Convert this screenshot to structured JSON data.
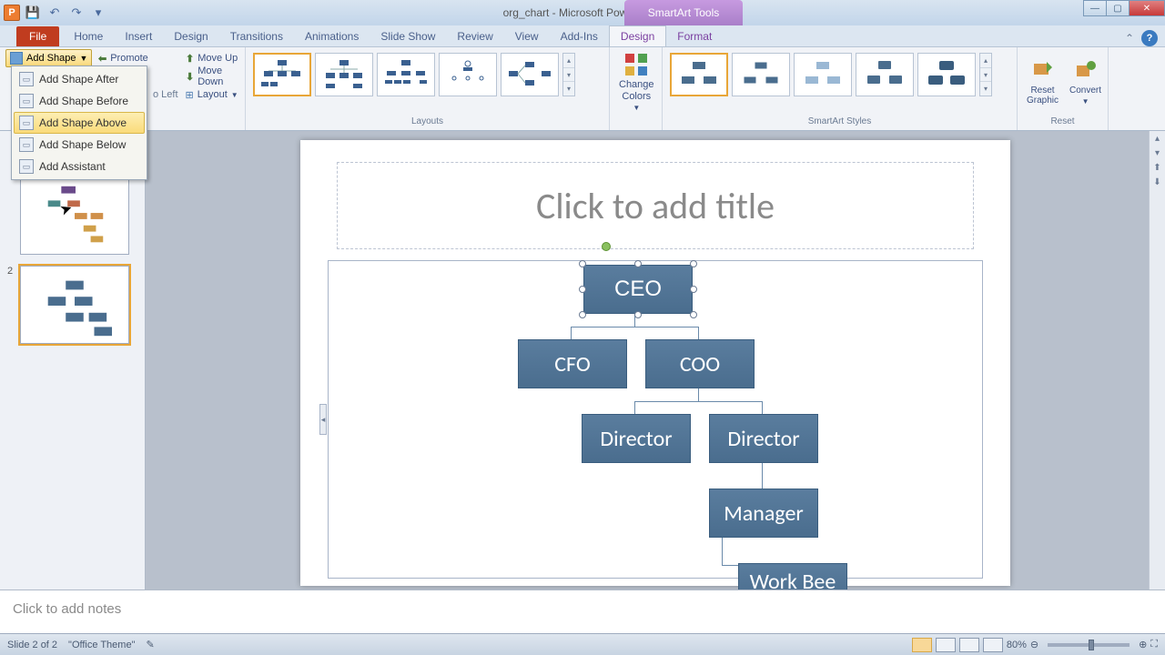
{
  "titlebar": {
    "app_icon_text": "P",
    "doc_title": "org_chart - Microsoft PowerPoint",
    "tools_label": "SmartArt Tools"
  },
  "tabs": {
    "file": "File",
    "home": "Home",
    "insert": "Insert",
    "design": "Design",
    "transitions": "Transitions",
    "animations": "Animations",
    "slideshow": "Slide Show",
    "review": "Review",
    "view": "View",
    "addins": "Add-Ins",
    "sa_design": "Design",
    "sa_format": "Format"
  },
  "ribbon": {
    "add_shape": "Add Shape",
    "promote": "Promote",
    "move_up": "Move Up",
    "move_down": "Move Down",
    "right_to_left": "o Left",
    "layout": "Layout",
    "layouts_label": "Layouts",
    "change_colors": "Change Colors",
    "styles_label": "SmartArt Styles",
    "reset_graphic": "Reset Graphic",
    "convert": "Convert",
    "reset_label": "Reset"
  },
  "dropdown": {
    "after": "Add Shape After",
    "before": "Add Shape Before",
    "above": "Add Shape Above",
    "below": "Add Shape Below",
    "assistant": "Add Assistant"
  },
  "slide": {
    "title_placeholder": "Click to add title",
    "notes_placeholder": "Click to add notes",
    "nodes": {
      "ceo": "CEO",
      "cfo": "CFO",
      "coo": "COO",
      "dir1": "Director",
      "dir2": "Director",
      "mgr": "Manager",
      "worker": "Work Bee"
    }
  },
  "thumbnails": {
    "slide2_num": "2"
  },
  "status": {
    "slide_info": "Slide 2 of 2",
    "theme": "\"Office Theme\"",
    "zoom": "80%"
  },
  "colors": {
    "node_fill": "#4f7293",
    "accent": "#e8a638"
  }
}
